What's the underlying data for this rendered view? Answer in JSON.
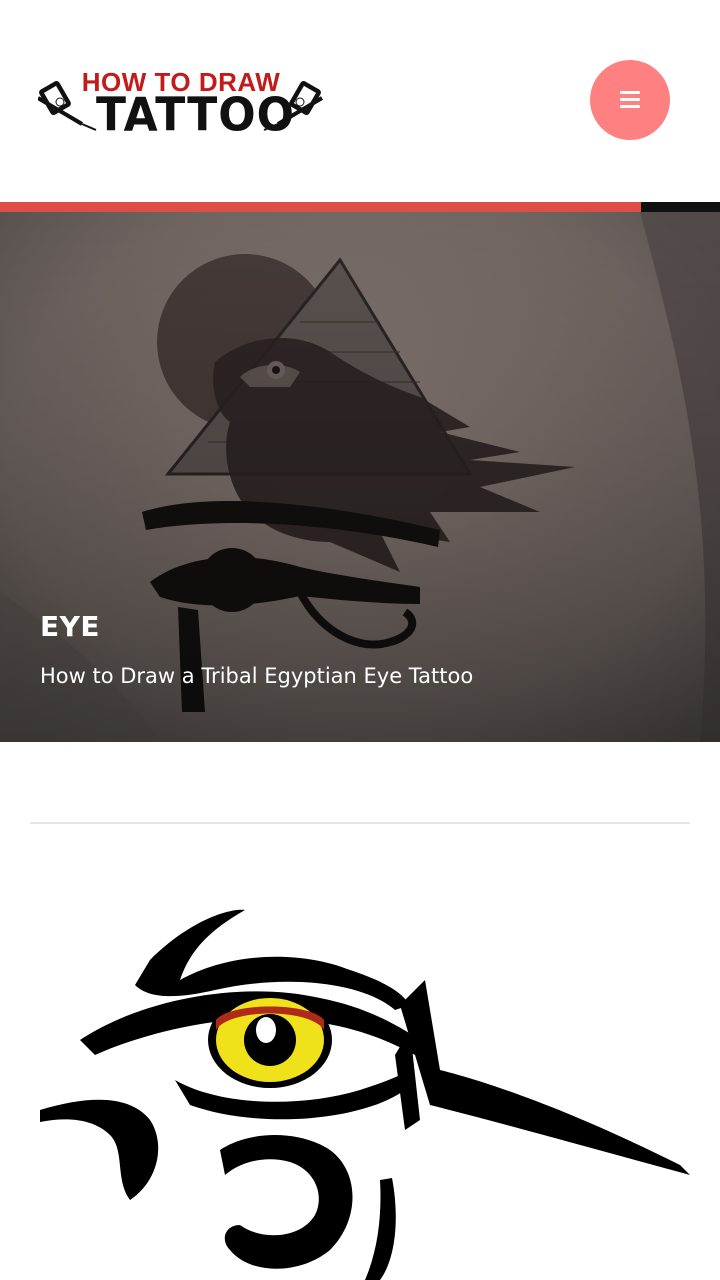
{
  "site": {
    "logo_line1": "HOW TO DRAW",
    "logo_line2": "TATTOO",
    "logo_icon": "tattoo-machine-icon"
  },
  "header": {
    "menu_icon": "hamburger-menu-icon",
    "menu_button_color": "#ff8080"
  },
  "reading_progress": {
    "fraction": 0.89,
    "color": "#dc4f47"
  },
  "featured": {
    "category": "EYE",
    "title": "How to Draw a Tribal Egyptian Eye Tattoo"
  },
  "colors": {
    "accent": "#dc4f47",
    "eye_iris": "#f0e21a",
    "eye_upper": "#b02a1a"
  }
}
